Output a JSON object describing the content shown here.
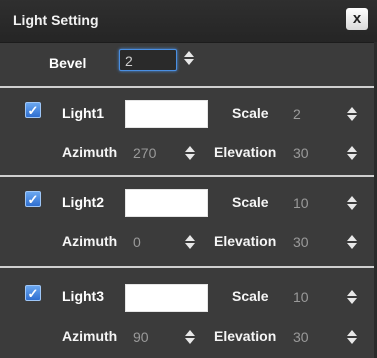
{
  "window": {
    "title": "Light Setting",
    "close_label": "x"
  },
  "bevel": {
    "label": "Bevel",
    "value": "2"
  },
  "labels": {
    "scale": "Scale",
    "azimuth": "Azimuth",
    "elevation": "Elevation"
  },
  "lights": [
    {
      "name": "Light1",
      "checked": true,
      "color": "#ffffff",
      "scale": "2",
      "azimuth": "270",
      "elevation": "30"
    },
    {
      "name": "Light2",
      "checked": true,
      "color": "#ffffff",
      "scale": "10",
      "azimuth": "0",
      "elevation": "30"
    },
    {
      "name": "Light3",
      "checked": true,
      "color": "#ffffff",
      "scale": "10",
      "azimuth": "90",
      "elevation": "30"
    }
  ],
  "icons": {
    "close": "close-icon",
    "check": "checkmark-icon",
    "stepper": "up-down-stepper-icon"
  }
}
